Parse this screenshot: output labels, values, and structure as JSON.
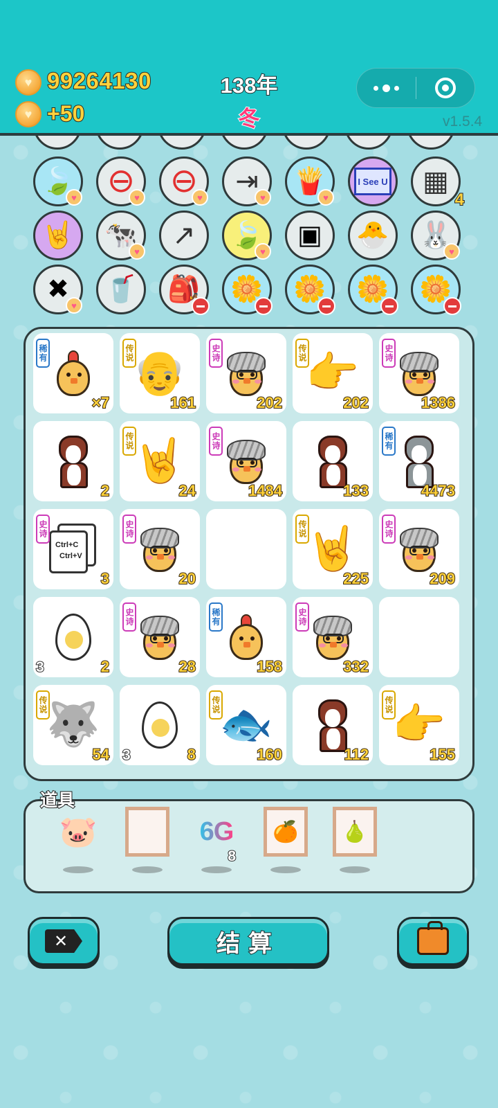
{
  "header": {
    "money": "99264130",
    "income": "+50",
    "year": "138年",
    "season": "冬",
    "version": "v1.5.4",
    "capsule_more": "more-icon",
    "capsule_close": "target-icon"
  },
  "colors": {
    "header_bg": "#1cc6c8",
    "page_bg": "#a4dde3",
    "number_yellow": "#ffd13a",
    "season_pink": "#ff3a7a"
  },
  "icon_rows": [
    [
      {
        "icon": "leaf-icon",
        "bg": "#a8e6f5",
        "badge": "heart"
      },
      {
        "icon": "no-entry-icon",
        "bg": "#e6ecec",
        "badge": "heart"
      },
      {
        "icon": "no-entry-icon",
        "bg": "#e6ecec",
        "badge": "heart"
      },
      {
        "icon": "skip-icon",
        "bg": "#e6ecec",
        "badge": "heart"
      },
      {
        "icon": "fries-icon",
        "bg": "#a8e6f5",
        "badge": "heart"
      },
      {
        "icon": "i-see-u-icon",
        "bg": "#d6a8f0",
        "badge": "",
        "text": "I See U"
      },
      {
        "icon": "egg-tray-icon",
        "bg": "#e6ecec",
        "badge": "",
        "count": "4"
      }
    ],
    [
      {
        "icon": "rock-hand-icon",
        "bg": "#d6a8f0",
        "badge": ""
      },
      {
        "icon": "cows-icon",
        "bg": "#e6ecec",
        "badge": "heart"
      },
      {
        "icon": "arrow-up-icon",
        "bg": "#e6ecec",
        "badge": ""
      },
      {
        "icon": "leaf-icon",
        "bg": "#f8f07a",
        "badge": "heart"
      },
      {
        "icon": "time-magazine-icon",
        "bg": "#e6ecec",
        "badge": ""
      },
      {
        "icon": "chick-egg-icon",
        "bg": "#e6ecec",
        "badge": ""
      },
      {
        "icon": "rabbit-icon",
        "bg": "#e6ecec",
        "badge": "heart"
      }
    ],
    [
      {
        "icon": "x-tag-icon",
        "bg": "#e6ecec",
        "badge": "heart"
      },
      {
        "icon": "tea-cup-icon",
        "bg": "#e6ecec",
        "badge": ""
      },
      {
        "icon": "sack-icon",
        "bg": "#e6ecec",
        "badge": "minus"
      },
      {
        "icon": "flower-pot-icon",
        "bg": "#a8e6f5",
        "badge": "minus"
      },
      {
        "icon": "flower-pot-icon",
        "bg": "#a8e6f5",
        "badge": "minus"
      },
      {
        "icon": "flower-pot-icon",
        "bg": "#a8e6f5",
        "badge": "minus"
      },
      {
        "icon": "flower-pot-icon",
        "bg": "#a8e6f5",
        "badge": "minus"
      }
    ]
  ],
  "grid": [
    [
      {
        "type": "chick",
        "tag": "稀有",
        "tag_kind": "rare",
        "num": "×7"
      },
      {
        "type": "bald-head",
        "tag": "传说",
        "tag_kind": "legend",
        "num": "161"
      },
      {
        "type": "grey-chick",
        "tag": "史诗",
        "tag_kind": "epic",
        "num": "202"
      },
      {
        "type": "point-hand",
        "tag": "传说",
        "tag_kind": "legend",
        "num": "202"
      },
      {
        "type": "grey-chick",
        "tag": "史诗",
        "tag_kind": "epic",
        "num": "1386"
      }
    ],
    [
      {
        "type": "dog-brown",
        "tag": "",
        "tag_kind": "",
        "num": "2"
      },
      {
        "type": "rock-hand",
        "tag": "传说",
        "tag_kind": "legend",
        "num": "24"
      },
      {
        "type": "grey-chick",
        "tag": "史诗",
        "tag_kind": "epic",
        "num": "1484"
      },
      {
        "type": "dog-brown",
        "tag": "",
        "tag_kind": "",
        "num": "133"
      },
      {
        "type": "dog-grey",
        "tag": "稀有",
        "tag_kind": "rare",
        "num": "4473"
      }
    ],
    [
      {
        "type": "copy-paste",
        "tag": "史诗",
        "tag_kind": "epic",
        "num": "3",
        "text1": "Ctrl+C",
        "text2": "Ctrl+V"
      },
      {
        "type": "grey-chick",
        "tag": "史诗",
        "tag_kind": "epic",
        "num": "20"
      },
      {
        "type": "empty",
        "tag": "",
        "tag_kind": "",
        "num": ""
      },
      {
        "type": "rock-hand",
        "tag": "传说",
        "tag_kind": "legend",
        "num": "225"
      },
      {
        "type": "grey-chick",
        "tag": "史诗",
        "tag_kind": "epic",
        "num": "209"
      }
    ],
    [
      {
        "type": "egg",
        "tag": "",
        "tag_kind": "",
        "num": "2",
        "left": "3"
      },
      {
        "type": "grey-chick",
        "tag": "史诗",
        "tag_kind": "epic",
        "num": "28"
      },
      {
        "type": "chick",
        "tag": "稀有",
        "tag_kind": "rare",
        "num": "158"
      },
      {
        "type": "grey-chick",
        "tag": "史诗",
        "tag_kind": "epic",
        "num": "332"
      },
      {
        "type": "empty",
        "tag": "",
        "tag_kind": "",
        "num": ""
      }
    ],
    [
      {
        "type": "husky-king",
        "tag": "传说",
        "tag_kind": "legend",
        "num": "54"
      },
      {
        "type": "egg",
        "tag": "",
        "tag_kind": "",
        "num": "8",
        "left": "3"
      },
      {
        "type": "koi",
        "tag": "传说",
        "tag_kind": "legend",
        "num": "160"
      },
      {
        "type": "dog-brown",
        "tag": "",
        "tag_kind": "",
        "num": "112"
      },
      {
        "type": "point-hand",
        "tag": "传说",
        "tag_kind": "legend",
        "num": "155"
      }
    ]
  ],
  "props": {
    "label": "道具",
    "items": [
      {
        "icon": "piggy-bank-icon",
        "kind": "pic"
      },
      {
        "icon": "empty-frame-icon",
        "kind": "frame"
      },
      {
        "icon": "6g-icon",
        "kind": "text",
        "text": "6G",
        "count": "8"
      },
      {
        "icon": "oranges-frame-icon",
        "kind": "frame"
      },
      {
        "icon": "pear-frame-icon",
        "kind": "frame"
      }
    ]
  },
  "buttons": {
    "discard_icon": "x-tag-icon",
    "settle_label": "结算",
    "bag_icon": "briefcase-icon"
  }
}
